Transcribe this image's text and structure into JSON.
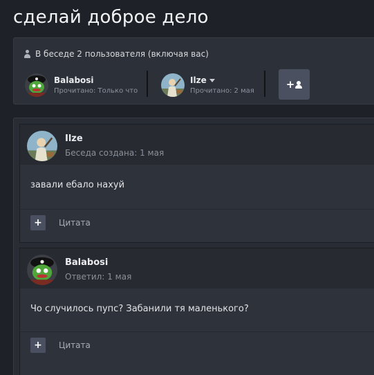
{
  "thread": {
    "title": "сделай доброе дело"
  },
  "participants": {
    "heading": "В беседе 2 пользователя (включая вас)",
    "members": [
      {
        "name": "Balabosi",
        "status": "Прочитано: Только что"
      },
      {
        "name": "Ilze",
        "status": "Прочитано: 2 мая"
      }
    ],
    "invite_glyph": "+"
  },
  "messages": [
    {
      "author": "Ilze",
      "meta": "Беседа создана: 1 мая",
      "body": "завали ебало нахуй",
      "quote_label": "Цитата",
      "quote_glyph": "+"
    },
    {
      "author": "Balabosi",
      "meta": "Ответил: 1 мая",
      "body": "Чо случилось пупс? Забанили тя маленького?",
      "quote_label": "Цитата",
      "quote_glyph": "+"
    }
  ]
}
